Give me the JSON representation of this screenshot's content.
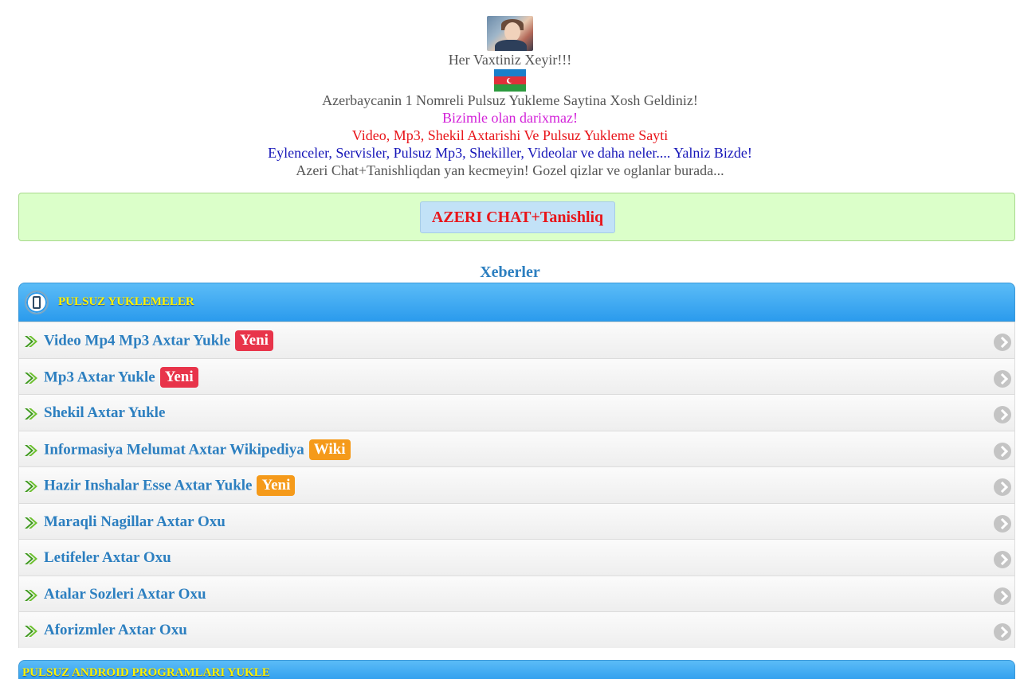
{
  "header": {
    "greeting": "Her Vaxtiniz Xeyir!!!",
    "welcome": "Azerbaycanin 1 Nomreli Pulsuz Yukleme Saytina Xosh Geldiniz!",
    "tagline_pink": "Bizimle olan darixmaz!",
    "tagline_red": "Video, Mp3, Shekil Axtarishi Ve Pulsuz Yukleme Sayti",
    "tagline_blue": "Eylenceler, Servisler, Pulsuz Mp3, Shekiller, Videolar ve daha neler.... Yalniz Bizde!",
    "tagline_gray": "Azeri Chat+Tanishliqdan yan kecmeyin! Gozel qizlar ve oglanlar burada..."
  },
  "chat": {
    "button_label": "AZERI CHAT+Tanishliq"
  },
  "news": {
    "label": "Xeberler"
  },
  "panel": {
    "title": "PULSUZ YUKLEMELER",
    "items": [
      {
        "label": "Video Mp4 Mp3 Axtar Yukle",
        "badge": "Yeni",
        "badge_color": "#e8344a"
      },
      {
        "label": "Mp3 Axtar Yukle",
        "badge": "Yeni",
        "badge_color": "#e8344a"
      },
      {
        "label": "Shekil Axtar Yukle"
      },
      {
        "label": "Informasiya Melumat Axtar Wikipediya",
        "badge": "Wiki",
        "badge_color": "#f59a1a"
      },
      {
        "label": "Hazir Inshalar Esse Axtar Yukle",
        "badge": "Yeni",
        "badge_color": "#f59a1a"
      },
      {
        "label": "Maraqli Nagillar Axtar Oxu"
      },
      {
        "label": "Letifeler Axtar Oxu"
      },
      {
        "label": "Atalar Sozleri Axtar Oxu"
      },
      {
        "label": "Aforizmler Axtar Oxu"
      }
    ]
  },
  "panel2": {
    "title": "PULSUZ ANDROID PROGRAMLARI YUKLE"
  },
  "colors": {
    "accent": "#2c7fc0",
    "header_blue": "#2b9bed",
    "title_yellow": "#fff300",
    "chat_bg": "#dbffc9"
  },
  "icons": {
    "row_arrow": "green-arrow-icon",
    "row_chevron": "chevron-right-icon",
    "panel": "phone-icon"
  }
}
